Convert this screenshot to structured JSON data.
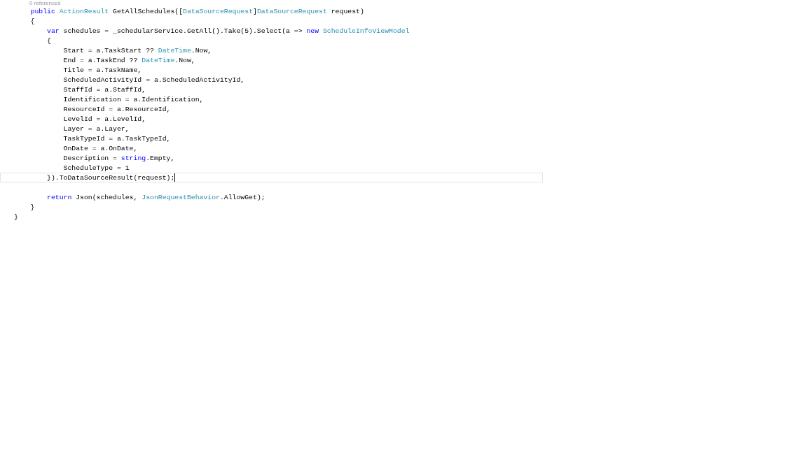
{
  "codelens": "0 references",
  "lines": [
    {
      "current": false,
      "tokens": [
        {
          "text": "    public",
          "kind": "keyword"
        },
        {
          "text": " ActionResult",
          "kind": "type"
        },
        {
          "text": " GetAllSchedules([",
          "kind": "plain"
        },
        {
          "text": "DataSourceRequest",
          "kind": "type"
        },
        {
          "text": "]",
          "kind": "plain"
        },
        {
          "text": "DataSourceRequest",
          "kind": "type"
        },
        {
          "text": " request)",
          "kind": "plain"
        }
      ]
    },
    {
      "current": false,
      "tokens": [
        {
          "text": "    {",
          "kind": "plain"
        }
      ]
    },
    {
      "current": false,
      "tokens": [
        {
          "text": "        var",
          "kind": "keyword"
        },
        {
          "text": " schedules = _schedularService.GetAll().Take(5).Select(a => ",
          "kind": "plain"
        },
        {
          "text": "new",
          "kind": "keyword"
        },
        {
          "text": " ScheduleInfoViewModel",
          "kind": "type"
        }
      ]
    },
    {
      "current": false,
      "tokens": [
        {
          "text": "        {",
          "kind": "plain"
        }
      ]
    },
    {
      "current": false,
      "tokens": [
        {
          "text": "            Start = a.TaskStart ?? ",
          "kind": "plain"
        },
        {
          "text": "DateTime",
          "kind": "type"
        },
        {
          "text": ".Now,",
          "kind": "plain"
        }
      ]
    },
    {
      "current": false,
      "tokens": [
        {
          "text": "            End = a.TaskEnd ?? ",
          "kind": "plain"
        },
        {
          "text": "DateTime",
          "kind": "type"
        },
        {
          "text": ".Now,",
          "kind": "plain"
        }
      ]
    },
    {
      "current": false,
      "tokens": [
        {
          "text": "            Title = a.TaskName,",
          "kind": "plain"
        }
      ]
    },
    {
      "current": false,
      "tokens": [
        {
          "text": "            ScheduledActivityId = a.ScheduledActivityId,",
          "kind": "plain"
        }
      ]
    },
    {
      "current": false,
      "tokens": [
        {
          "text": "            StaffId = a.StaffId,",
          "kind": "plain"
        }
      ]
    },
    {
      "current": false,
      "tokens": [
        {
          "text": "            Identification = a.Identification,",
          "kind": "plain"
        }
      ]
    },
    {
      "current": false,
      "tokens": [
        {
          "text": "            ResourceId = a.ResourceId,",
          "kind": "plain"
        }
      ]
    },
    {
      "current": false,
      "tokens": [
        {
          "text": "            LevelId = a.LevelId,",
          "kind": "plain"
        }
      ]
    },
    {
      "current": false,
      "tokens": [
        {
          "text": "            Layer = a.Layer,",
          "kind": "plain"
        }
      ]
    },
    {
      "current": false,
      "tokens": [
        {
          "text": "            TaskTypeId = a.TaskTypeId,",
          "kind": "plain"
        }
      ]
    },
    {
      "current": false,
      "tokens": [
        {
          "text": "            OnDate = a.OnDate,",
          "kind": "plain"
        }
      ]
    },
    {
      "current": false,
      "tokens": [
        {
          "text": "            Description = ",
          "kind": "plain"
        },
        {
          "text": "string",
          "kind": "keyword"
        },
        {
          "text": ".Empty,",
          "kind": "plain"
        }
      ]
    },
    {
      "current": false,
      "tokens": [
        {
          "text": "            ScheduleType = 1",
          "kind": "plain"
        }
      ]
    },
    {
      "current": true,
      "tokens": [
        {
          "text": "        }).ToDataSourceResult(request);",
          "kind": "plain"
        }
      ]
    },
    {
      "current": false
    },
    {
      "current": false,
      "tokens": [
        {
          "text": "        return",
          "kind": "keyword"
        },
        {
          "text": " Json(schedules, ",
          "kind": "plain"
        },
        {
          "text": "JsonRequestBehavior",
          "kind": "type"
        },
        {
          "text": ".AllowGet);",
          "kind": "plain"
        }
      ]
    },
    {
      "current": false,
      "tokens": [
        {
          "text": "    }",
          "kind": "plain"
        }
      ]
    },
    {
      "current": false,
      "tokens": [
        {
          "text": "}",
          "kind": "plain"
        }
      ]
    }
  ]
}
